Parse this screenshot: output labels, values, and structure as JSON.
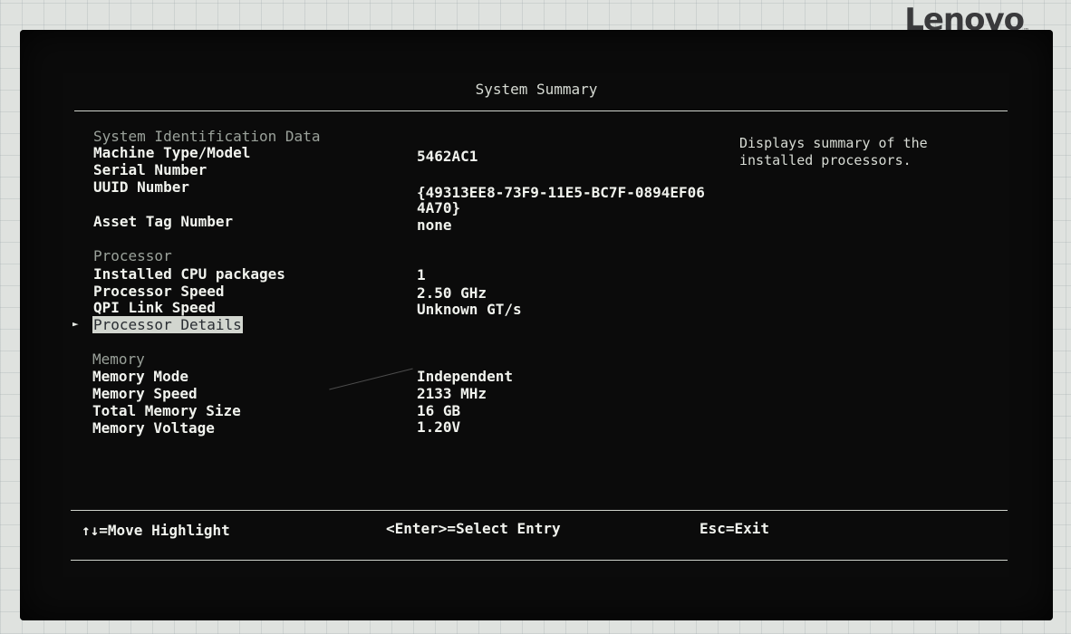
{
  "brand": {
    "logo": "Lenovo"
  },
  "header": {
    "title": "System Summary"
  },
  "help_text": [
    "Displays summary of the",
    "installed processors."
  ],
  "identification": {
    "section_title": "System Identification Data",
    "machine_type_label": "Machine Type/Model",
    "machine_type_value": "5462AC1",
    "serial_label": "Serial Number",
    "serial_value": "",
    "uuid_label": "UUID Number",
    "uuid_value_line1": "{49313EE8-73F9-11E5-BC7F-0894EF06",
    "uuid_value_line2": "4A70}",
    "asset_tag_label": "Asset Tag Number",
    "asset_tag_value": "none"
  },
  "processor": {
    "section_title": "Processor",
    "cpu_packages_label": "Installed CPU packages",
    "cpu_packages_value": "1",
    "speed_label": "Processor Speed",
    "speed_value": "2.50 GHz",
    "qpi_label": "QPI Link Speed",
    "qpi_value": "Unknown GT/s",
    "details_label": "Processor Details",
    "pointer": "►"
  },
  "memory": {
    "section_title": "Memory",
    "mode_label": "Memory Mode",
    "mode_value": "Independent",
    "speed_label": "Memory Speed",
    "speed_value": "2133 MHz",
    "total_label": "Total Memory Size",
    "total_value": "16 GB",
    "voltage_label": "Memory Voltage",
    "voltage_value": "1.20V"
  },
  "footer": {
    "move": "↑↓=Move Highlight",
    "select": "<Enter>=Select Entry",
    "exit": "Esc=Exit"
  }
}
